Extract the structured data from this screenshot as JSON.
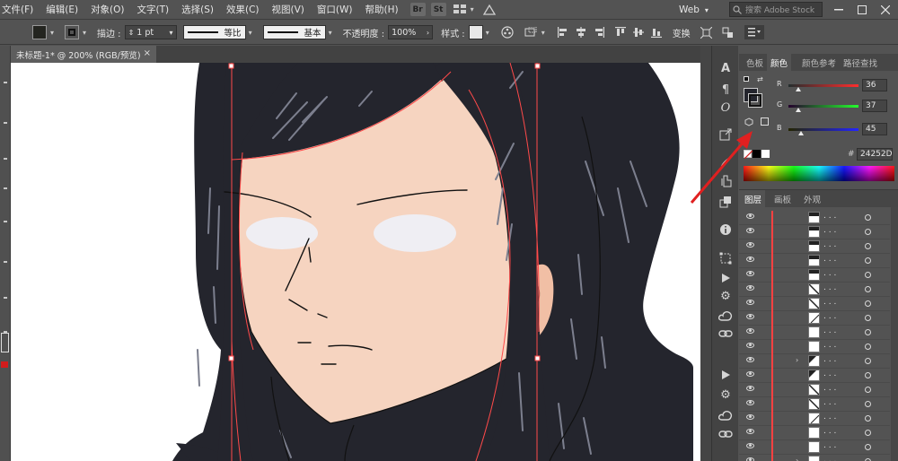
{
  "menubar": {
    "items": [
      "文件(F)",
      "编辑(E)",
      "对象(O)",
      "文字(T)",
      "选择(S)",
      "效果(C)",
      "视图(V)",
      "窗口(W)",
      "帮助(H)"
    ],
    "bridge_badge": "Br",
    "stock_badge": "St",
    "workspace": "Web",
    "search_placeholder": "搜索 Adobe Stock"
  },
  "controlbar": {
    "fill_color": "#242520",
    "stroke_label": "描边 :",
    "stroke_weight": "1 pt",
    "profile_label": "等比",
    "brush_label": "基本",
    "opacity_label": "不透明度 :",
    "opacity_value": "100%",
    "style_label": "样式 :",
    "transform_label": "变换"
  },
  "document": {
    "tab_title": "未标题-1* @ 200% (RGB/预览)",
    "close_glyph": "×"
  },
  "color_panel": {
    "tabs": [
      "色板",
      "颜色",
      "颜色参考",
      "路径查找"
    ],
    "active_tab": "颜色",
    "r_label": "R",
    "g_label": "G",
    "b_label": "B",
    "r_value": "36",
    "g_value": "37",
    "b_value": "45",
    "r": 36,
    "g": 37,
    "b": 45,
    "hex_label": "#",
    "hex_value": "24252D"
  },
  "layers_panel": {
    "tabs": [
      "图层",
      "画板",
      "外观"
    ],
    "active_tab": "图层",
    "rows": [
      {
        "name": ". . .",
        "expand": ""
      },
      {
        "name": ". . .",
        "expand": ""
      },
      {
        "name": ". . .",
        "expand": ""
      },
      {
        "name": ". . .",
        "expand": ""
      },
      {
        "name": ". . .",
        "expand": ""
      },
      {
        "name": ". . .",
        "expand": ""
      },
      {
        "name": ". . .",
        "expand": ""
      },
      {
        "name": ". . .",
        "expand": ""
      },
      {
        "name": ". . .",
        "expand": ""
      },
      {
        "name": ". . .",
        "expand": ""
      },
      {
        "name": ". . .",
        "expand": "›"
      },
      {
        "name": ". . .",
        "expand": ""
      },
      {
        "name": ". . .",
        "expand": ""
      },
      {
        "name": ". . .",
        "expand": ""
      },
      {
        "name": ". . .",
        "expand": ""
      },
      {
        "name": ". . .",
        "expand": ""
      },
      {
        "name": ". . .",
        "expand": ""
      },
      {
        "name": ". . .",
        "expand": "›"
      }
    ]
  },
  "colors": {
    "hair": "#24252d",
    "skin": "#f6d4c0",
    "ear": "#f1bfa5",
    "eye": "#efeef3",
    "guide": "#ff4a4a"
  }
}
